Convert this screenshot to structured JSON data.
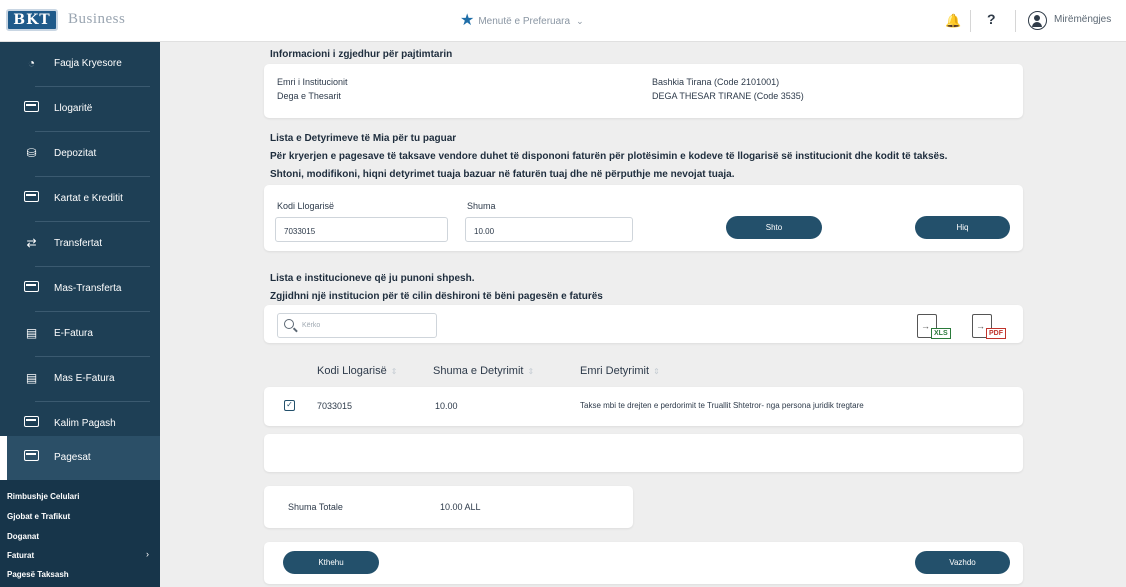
{
  "header": {
    "logo": "BKT",
    "product": "Business",
    "favorites_label": "Menutë e Preferuara",
    "help_label": "?",
    "greeting": "Mirëmëngjes"
  },
  "sidebar": {
    "items": [
      {
        "label": "Faqja Kryesore",
        "icon": "home-icon"
      },
      {
        "label": "Llogaritë",
        "icon": "card-icon"
      },
      {
        "label": "Depozitat",
        "icon": "deposit-icon"
      },
      {
        "label": "Kartat e Kreditit",
        "icon": "card-icon"
      },
      {
        "label": "Transfertat",
        "icon": "transfer-icon"
      },
      {
        "label": "Mas-Transferta",
        "icon": "card-icon"
      },
      {
        "label": "E-Fatura",
        "icon": "invoice-icon"
      },
      {
        "label": "Mas E-Fatura",
        "icon": "invoice-icon"
      },
      {
        "label": "Kalim Pagash",
        "icon": "card-icon"
      },
      {
        "label": "Pagesat",
        "icon": "card-icon"
      }
    ],
    "submenu": [
      "Rimbushje Celulari",
      "Gjobat e Trafikut",
      "Doganat",
      "Faturat",
      "Pagesë Taksash"
    ]
  },
  "info": {
    "title": "Informacioni i zgjedhur për pajtimtarin",
    "institution_label": "Emri i Institucionit",
    "institution_value": "Bashkia Tirana (Code 2101001)",
    "branch_label": "Dega e Thesarit",
    "branch_value": "DEGA THESAR TIRANE (Code 3535)"
  },
  "obligations": {
    "title": "Lista e Detyrimeve të Mia për tu paguar",
    "line1": "Për kryerjen e pagesave të taksave vendore duhet të dispononi faturën për plotësimin e kodeve të llogarisë së institucionit dhe kodit të taksës.",
    "line2": "Shtoni, modifikoni, hiqni detyrimet tuaja bazuar në faturën tuaj dhe në përputhje me nevojat tuaja.",
    "account_label": "Kodi Llogarisë",
    "account_value": "7033015",
    "amount_label": "Shuma",
    "amount_value": "10.00",
    "add_button": "Shto",
    "remove_button": "Hiq"
  },
  "institutions": {
    "title": "Lista e institucioneve që ju punoni shpesh.",
    "subtitle": "Zgjidhni një institucion për të cilin dëshironi të bëni pagesën e faturës",
    "search_placeholder": "Kërko",
    "export_xls": "XLS",
    "export_pdf": "PDF"
  },
  "table": {
    "columns": [
      "Kodi Llogarisë",
      "Shuma e Detyrimit",
      "Emri Detyrimit"
    ],
    "rows": [
      {
        "account": "7033015",
        "amount": "10.00",
        "name": "Takse mbi te drejten e perdorimit te Truallit Shtetror- nga persona juridik tregtare",
        "checked": true
      }
    ]
  },
  "total": {
    "label": "Shuma Totale",
    "value": "10.00 ALL"
  },
  "footer": {
    "back_button": "Kthehu",
    "continue_button": "Vazhdo"
  },
  "colors": {
    "sidebar": "#1e3f55",
    "button": "#23506b",
    "accent_star": "#1f6ea8"
  }
}
